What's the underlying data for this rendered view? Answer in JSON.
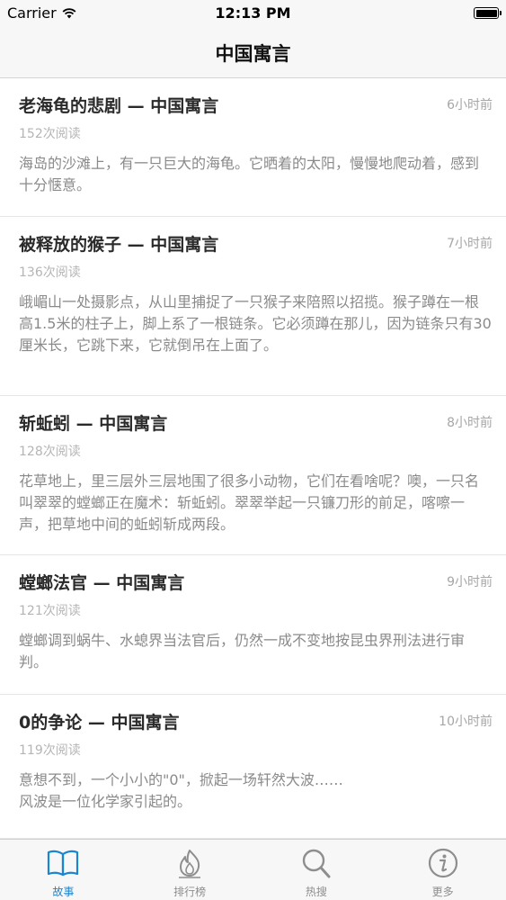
{
  "status_bar": {
    "carrier": "Carrier",
    "time": "12:13 PM"
  },
  "nav": {
    "title": "中国寓言"
  },
  "stories": [
    {
      "title": "老海龟的悲剧 — 中国寓言",
      "time": "6小时前",
      "reads": "152次阅读",
      "excerpt": "海岛的沙滩上，有一只巨大的海龟。它晒着的太阳，慢慢地爬动着，感到十分惬意。"
    },
    {
      "title": "被释放的猴子 — 中国寓言",
      "time": "7小时前",
      "reads": "136次阅读",
      "excerpt": "峨嵋山一处摄影点，从山里捕捉了一只猴子来陪照以招揽。猴子蹲在一根高1.5米的柱子上，脚上系了一根链条。它必须蹲在那儿，因为链条只有30厘米长，它跳下来，它就倒吊在上面了。"
    },
    {
      "title": "斩蚯蚓 — 中国寓言",
      "time": "8小时前",
      "reads": "128次阅读",
      "excerpt": "花草地上，里三层外三层地围了很多小动物，它们在看啥呢？噢，一只名叫翠翠的螳螂正在魔术：斩蚯蚓。翠翠举起一只镰刀形的前足，喀嚓一声，把草地中间的蚯蚓斩成两段。"
    },
    {
      "title": "螳螂法官 — 中国寓言",
      "time": "9小时前",
      "reads": "121次阅读",
      "excerpt": "螳螂调到蜗牛、水螅界当法官后，仍然一成不变地按昆虫界刑法进行审判。"
    },
    {
      "title": "0的争论 — 中国寓言",
      "time": "10小时前",
      "reads": "119次阅读",
      "excerpt": "意想不到，一个小小的\"0\"，掀起一场轩然大波……\n风波是一位化学家引起的。"
    }
  ],
  "tabs": [
    {
      "label": "故事",
      "icon": "book-icon",
      "active": true
    },
    {
      "label": "排行榜",
      "icon": "fire-icon",
      "active": false
    },
    {
      "label": "热搜",
      "icon": "search-icon",
      "active": false
    },
    {
      "label": "更多",
      "icon": "info-icon",
      "active": false
    }
  ],
  "colors": {
    "accent": "#1a86d0",
    "inactive": "#8e8e8e"
  }
}
